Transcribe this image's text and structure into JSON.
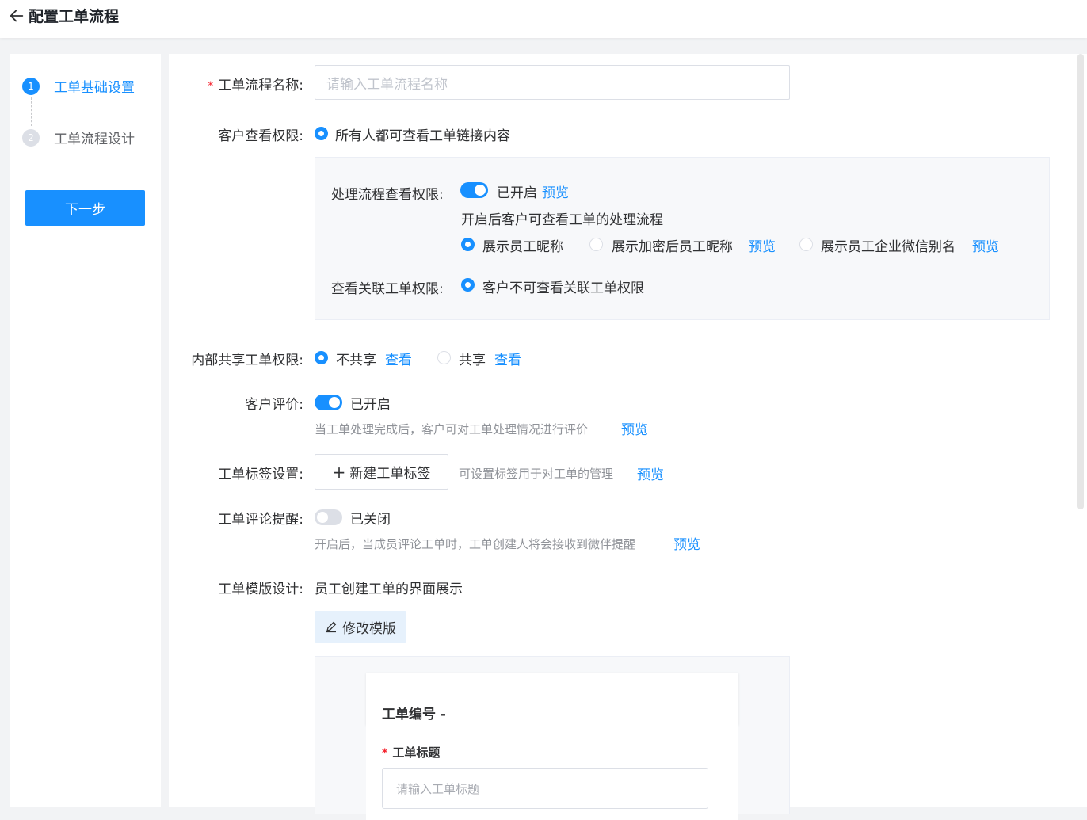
{
  "header": {
    "title": "配置工单流程"
  },
  "steps": [
    {
      "num": "1",
      "label": "工单基础设置"
    },
    {
      "num": "2",
      "label": "工单流程设计"
    }
  ],
  "next_button": "下一步",
  "form": {
    "name": {
      "label": "工单流程名称:",
      "placeholder": "请输入工单流程名称"
    },
    "customer_view": {
      "label": "客户查看权限:",
      "option": "所有人都可查看工单链接内容"
    },
    "process_view": {
      "label": "处理流程查看权限:",
      "status": "已开启",
      "preview": "预览",
      "desc": "开启后客户可查看工单的处理流程",
      "options": [
        "展示员工昵称",
        "展示加密后员工昵称",
        "展示员工企业微信别名"
      ],
      "option_previews": [
        "预览",
        "预览"
      ]
    },
    "related_view": {
      "label": "查看关联工单权限:",
      "option": "客户不可查看关联工单权限"
    },
    "internal_share": {
      "label": "内部共享工单权限:",
      "options": [
        "不共享",
        "共享"
      ],
      "links": [
        "查看",
        "查看"
      ]
    },
    "evaluation": {
      "label": "客户评价:",
      "status": "已开启",
      "desc": "当工单处理完成后，客户可对工单处理情况进行评价",
      "preview": "预览"
    },
    "tags": {
      "label": "工单标签设置:",
      "button": "新建工单标签",
      "desc": "可设置标签用于对工单的管理",
      "preview": "预览"
    },
    "comment_remind": {
      "label": "工单评论提醒:",
      "status": "已关闭",
      "desc": "开启后，当成员评论工单时，工单创建人将会接收到微伴提醒",
      "preview": "预览"
    },
    "template": {
      "label": "工单模版设计:",
      "desc": "员工创建工单的界面展示",
      "button": "修改模版"
    }
  },
  "template_preview": {
    "title": "工单编号 -",
    "field_label": "工单标题",
    "field_placeholder": "请输入工单标题"
  },
  "colors": {
    "primary": "#1890ff",
    "required": "#f5222d"
  }
}
